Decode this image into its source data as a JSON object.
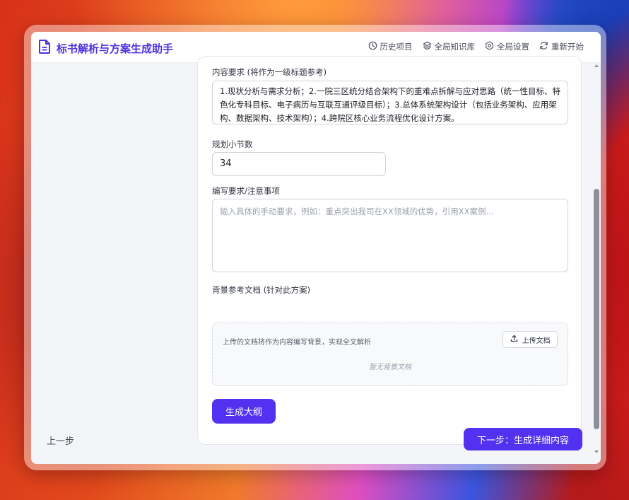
{
  "app": {
    "title": "标书解析与方案生成助手"
  },
  "nav": {
    "history": "历史项目",
    "knowledge": "全局知识库",
    "settings": "全局设置",
    "restart": "重新开始"
  },
  "form": {
    "content_label": "内容要求 (将作为一级标题参考)",
    "content_value": "1.现状分析与需求分析；2.一院三区统分结合架构下的重难点拆解与应对思路（统一性目标、特色化专科目标、电子病历与互联互通评级目标）；3.总体系统架构设计（包括业务架构、应用架构、数据架构、技术架构）；4.跨院区核心业务流程优化设计方案。",
    "sections_label": "规划小节数",
    "sections_value": "34",
    "notes_label": "编写要求/注意事项",
    "notes_placeholder": "输入具体的手动要求，例如：重点突出我司在XX领域的优势，引用XX案例...",
    "bg_label": "背景参考文档 (针对此方案)",
    "bg_hint": "上传的文档将作为内容编写背景，实现全文解析",
    "upload_label": "上传文档",
    "empty_text": "暂无背景文档",
    "generate_label": "生成大纲"
  },
  "footer": {
    "prev_label": "上一步",
    "next_label": "下一步：生成详细内容"
  },
  "colors": {
    "accent": "#5232f0",
    "brand": "#4b33e0"
  }
}
